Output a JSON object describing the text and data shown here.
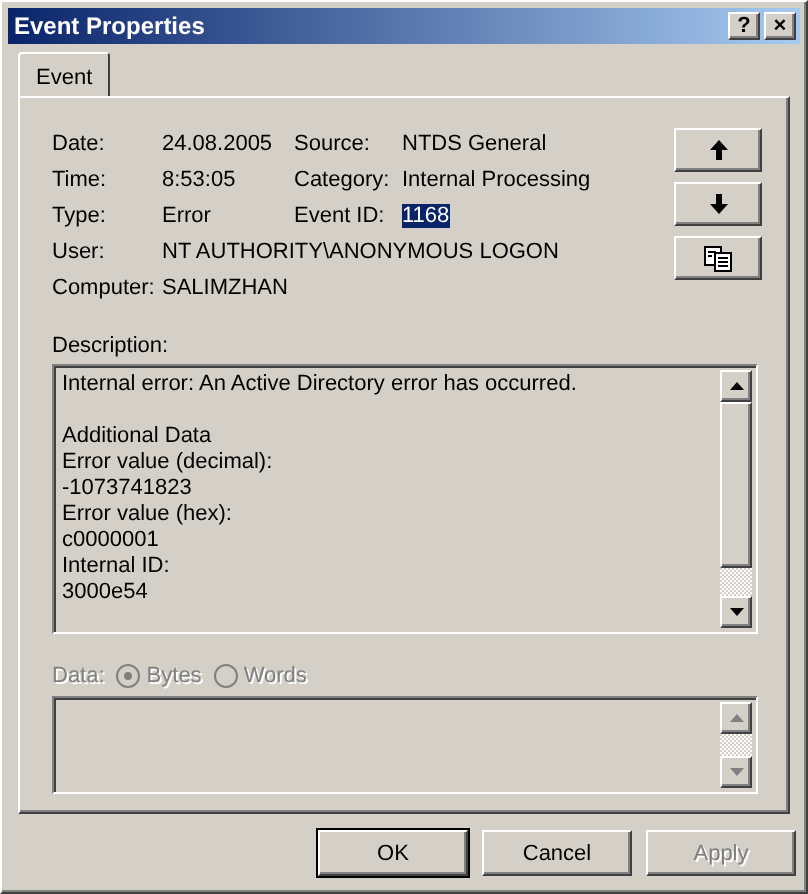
{
  "window": {
    "title": "Event Properties",
    "controls": [
      {
        "kind": "help",
        "label": "?"
      },
      {
        "kind": "close",
        "label": "×"
      }
    ]
  },
  "tabs": [
    {
      "label": "Event",
      "selected": true
    }
  ],
  "details": [
    {
      "cells": [
        {
          "label": "Date:",
          "value": "24.08.2005",
          "highlighted": false
        },
        {
          "label": "Source:",
          "value": "NTDS General",
          "highlighted": false
        }
      ]
    },
    {
      "cells": [
        {
          "label": "Time:",
          "value": "8:53:05",
          "highlighted": false
        },
        {
          "label": "Category:",
          "value": "Internal Processing",
          "highlighted": false
        }
      ]
    },
    {
      "cells": [
        {
          "label": "Type:",
          "value": "Error",
          "highlighted": false
        },
        {
          "label": "Event ID:",
          "value": "1168",
          "highlighted": true
        }
      ]
    },
    {
      "cells": [
        {
          "label": "User:",
          "value": "NT AUTHORITY\\ANONYMOUS LOGON",
          "highlighted": false
        }
      ]
    },
    {
      "cells": [
        {
          "label": "Computer:",
          "value": "SALIMZHAN",
          "highlighted": false
        }
      ]
    }
  ],
  "nav_buttons": [
    {
      "kind": "up"
    },
    {
      "kind": "down"
    },
    {
      "kind": "copy"
    }
  ],
  "description": {
    "label": "Description:",
    "paragraphs": [
      [
        "Internal error: An Active Directory error has occurred."
      ],
      [
        "Additional Data",
        "Error value (decimal):",
        "-1073741823",
        "Error value (hex):",
        "c0000001",
        "Internal ID:",
        "3000e54"
      ]
    ]
  },
  "data": {
    "label": "Data:",
    "disabled": true,
    "options": [
      {
        "label": "Bytes",
        "selected": true
      },
      {
        "label": "Words",
        "selected": false
      }
    ]
  },
  "buttons": [
    {
      "label": "OK",
      "default": true,
      "disabled": false
    },
    {
      "label": "Cancel",
      "default": false,
      "disabled": false
    },
    {
      "label": "Apply",
      "default": false,
      "disabled": true
    }
  ]
}
